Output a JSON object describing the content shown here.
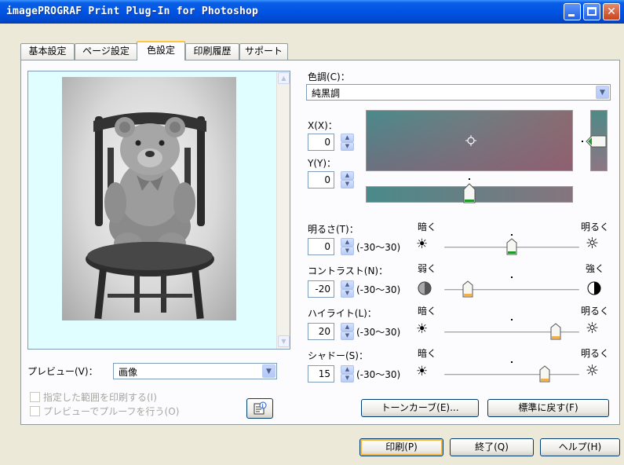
{
  "window": {
    "title": "imagePROGRAF Print Plug-In for Photoshop"
  },
  "tabs": [
    "基本設定",
    "ページ設定",
    "色設定",
    "印刷履歴",
    "サポート"
  ],
  "active_tab": "色設定",
  "preview": {
    "label": "プレビュー(V)：",
    "mode_value": "画像",
    "print_selection_label": "指定した範囲を印刷する(I)",
    "proof_label": "プレビューでプルーフを行う(O)"
  },
  "color_tone": {
    "label": "色調(C)：",
    "value": "純黒調",
    "x_label": "X(X)：",
    "x_value": "0",
    "y_label": "Y(Y)：",
    "y_value": "0"
  },
  "adjustments": [
    {
      "label": "明るさ(T)：",
      "value": "0",
      "range": "(-30〜30)",
      "left_label": "暗く",
      "right_label": "明るく",
      "level": 0
    },
    {
      "label": "コントラスト(N)：",
      "value": "-20",
      "range": "(-30〜30)",
      "left_label": "弱く",
      "right_label": "強く",
      "level": -20
    },
    {
      "label": "ハイライト(L)：",
      "value": "20",
      "range": "(-30〜30)",
      "left_label": "暗く",
      "right_label": "明るく",
      "level": 20
    },
    {
      "label": "シャドー(S)：",
      "value": "15",
      "range": "(-30〜30)",
      "left_label": "暗く",
      "right_label": "明るく",
      "level": 15
    }
  ],
  "buttons": {
    "tone_curve": "トーンカーブ(E)...",
    "reset": "標準に戻す(F)",
    "print": "印刷(P)",
    "exit": "終了(Q)",
    "help": "ヘルプ(H)"
  },
  "colors": {
    "title_bar": "#0054e3",
    "preview_bg": "#e0fdff",
    "slider_thumb_active": "#1f9b2e",
    "slider_thumb": "#f0b04c"
  }
}
